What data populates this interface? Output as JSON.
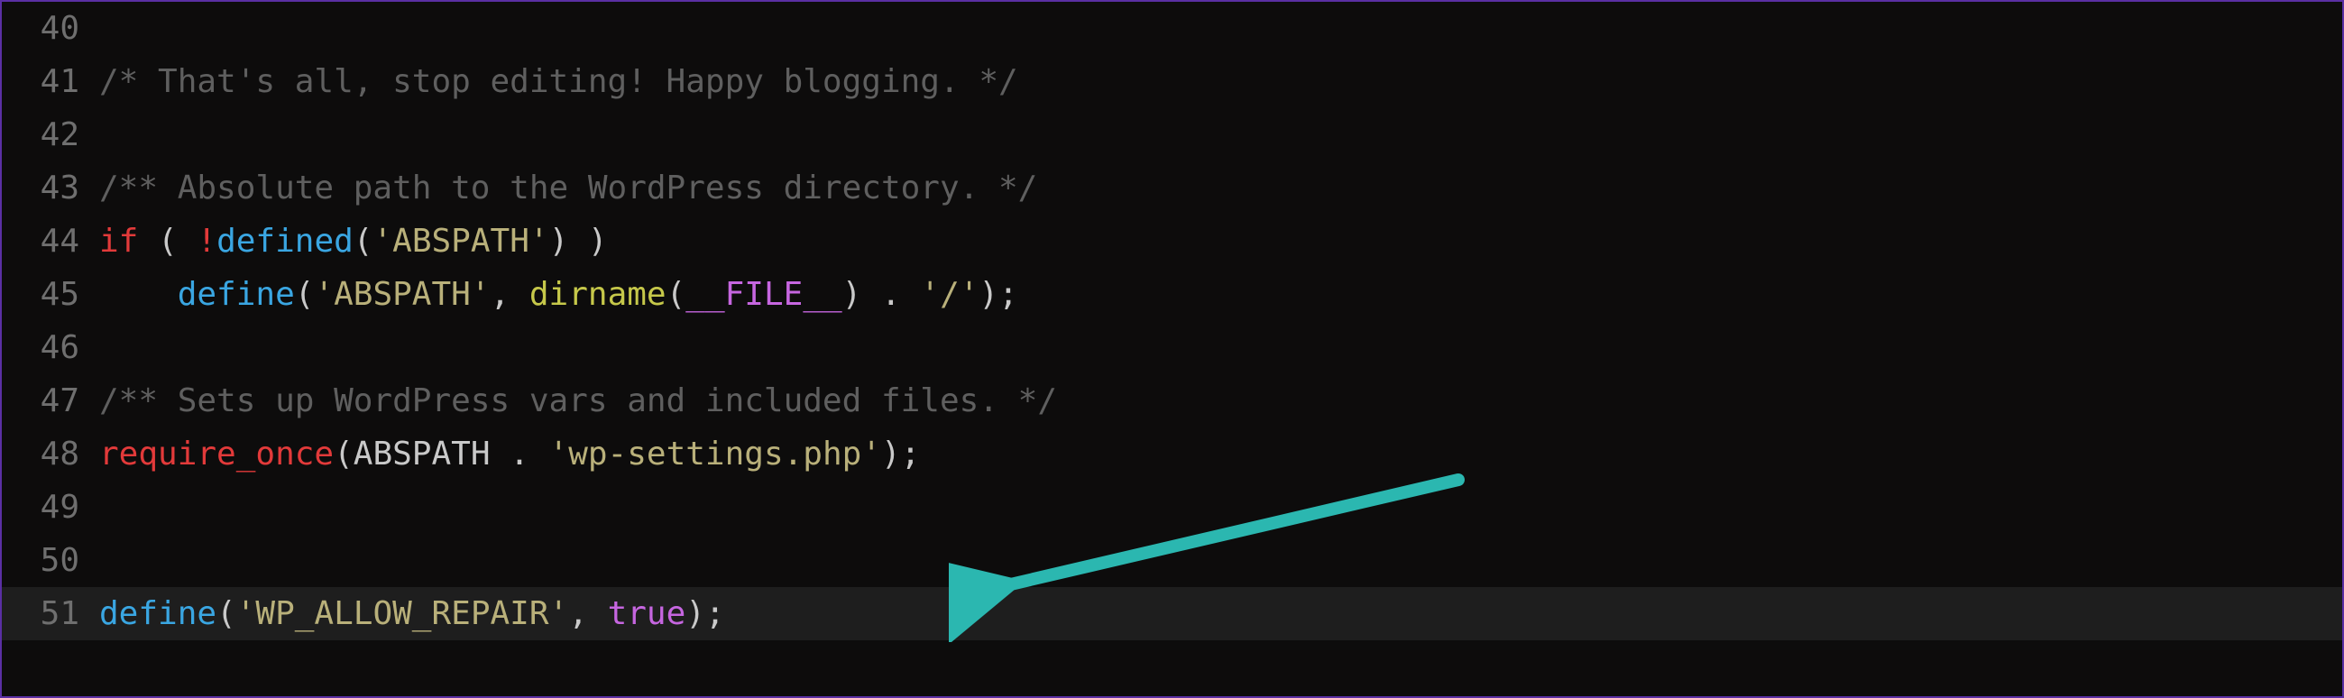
{
  "lines": {
    "40": {
      "num": "40"
    },
    "41": {
      "num": "41",
      "comment": "/* That's all, stop editing! Happy blogging. */"
    },
    "42": {
      "num": "42"
    },
    "43": {
      "num": "43",
      "comment": "/** Absolute path to the WordPress directory. */"
    },
    "44": {
      "num": "44",
      "if": "if",
      "lp": " ( ",
      "bang": "!",
      "defined": "defined",
      "lp2": "(",
      "str": "'ABSPATH'",
      "rp2": ")",
      "rp": " )"
    },
    "45": {
      "num": "45",
      "indent": "    ",
      "define": "define",
      "lp": "(",
      "str1": "'ABSPATH'",
      "comma": ", ",
      "dirname": "dirname",
      "lp2": "(",
      "file": "__FILE__",
      "rp2": ")",
      "dot": " . ",
      "str2": "'/'",
      "rp_semi": ");"
    },
    "46": {
      "num": "46"
    },
    "47": {
      "num": "47",
      "comment": "/** Sets up WordPress vars and included files. */"
    },
    "48": {
      "num": "48",
      "require": "require_once",
      "lp": "(",
      "abspath": "ABSPATH",
      "dot": " . ",
      "str": "'wp-settings.php'",
      "rp_semi": ");"
    },
    "49": {
      "num": "49"
    },
    "50": {
      "num": "50"
    },
    "51": {
      "num": "51",
      "define": "define",
      "lp": "(",
      "str": "'WP_ALLOW_REPAIR'",
      "comma": ", ",
      "true": "true",
      "rp_semi": ");"
    }
  },
  "annotation": {
    "arrow_color": "#2bb7b0"
  }
}
